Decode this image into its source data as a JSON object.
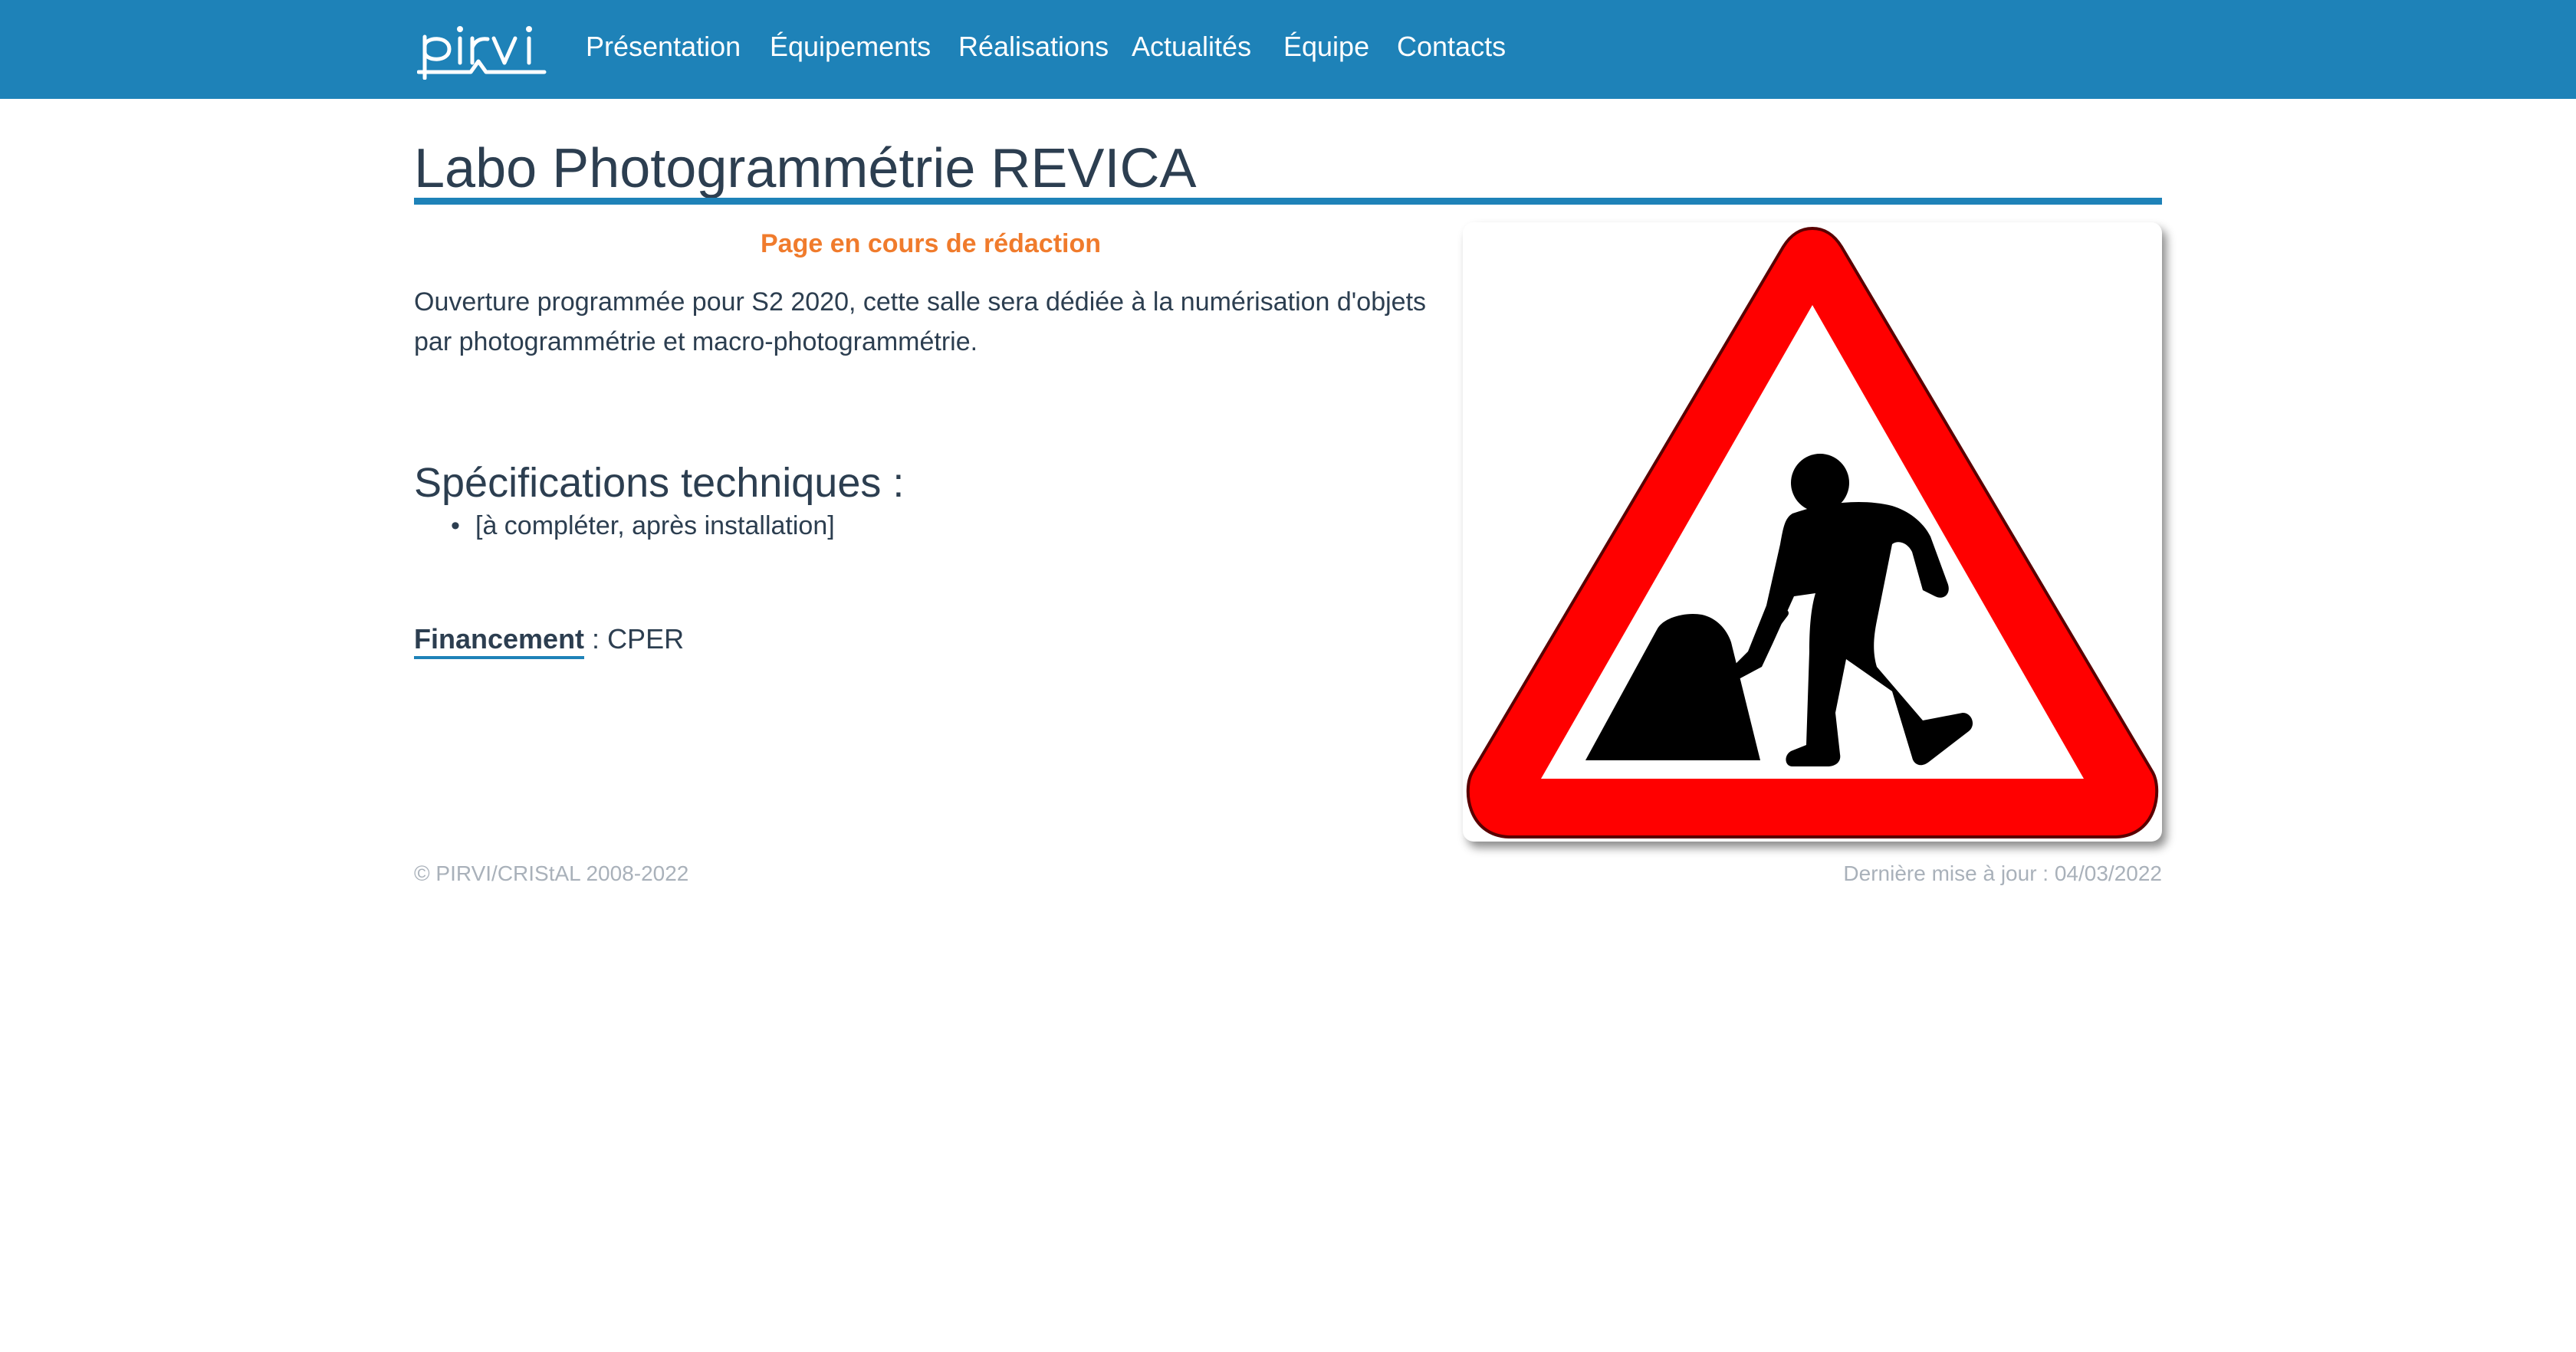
{
  "header": {
    "logo_text": "pirvi",
    "nav": [
      {
        "label": "Présentation"
      },
      {
        "label": "Équipements"
      },
      {
        "label": "Réalisations"
      },
      {
        "label": "Actualités"
      },
      {
        "label": "Équipe"
      },
      {
        "label": "Contacts"
      }
    ],
    "colors": {
      "bar": "#1e82b8",
      "text": "#ffffff"
    }
  },
  "main": {
    "title": "Labo Photogrammétrie REVICA",
    "notice": "Page en cours de rédaction",
    "intro": "Ouverture programmée pour S2 2020, cette salle sera dédiée à la numérisation d'objets par photogrammétrie et macro-photogrammétrie.",
    "specs": {
      "heading": "Spécifications techniques :",
      "items": [
        "[à compléter, après installation]"
      ]
    },
    "funding": {
      "label": "Financement",
      "separator": " : ",
      "value": "CPER"
    },
    "image": {
      "icon": "road-works-sign-icon",
      "colors": {
        "border": "#ff0000",
        "figure": "#000000",
        "background": "#ffffff"
      }
    }
  },
  "footer": {
    "copyright": "© PIRVI/CRIStAL 2008-2022",
    "updated": "Dernière mise à jour : 04/03/2022"
  }
}
